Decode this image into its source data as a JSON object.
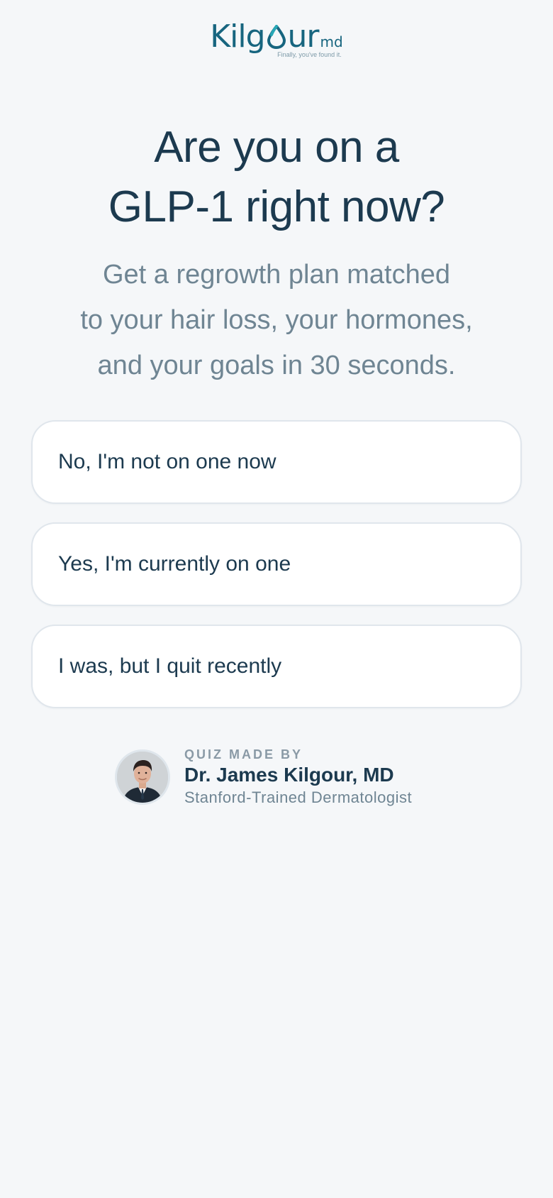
{
  "brand": {
    "logo_word_start": "Kilg",
    "logo_word_end": "ur",
    "logo_suffix": "md",
    "tagline": "Finally, you've found it."
  },
  "question": {
    "headline_line1": "Are you on a",
    "headline_line2": "GLP-1 right now?",
    "subhead_line1": "Get a regrowth plan matched",
    "subhead_line2": "to your hair loss, your hormones,",
    "subhead_line3": "and your goals in 30 seconds."
  },
  "options": [
    {
      "label": "No, I'm not on one now"
    },
    {
      "label": "Yes, I'm currently on one"
    },
    {
      "label": "I was, but I quit recently"
    }
  ],
  "author": {
    "eyebrow": "QUIZ MADE BY",
    "name": "Dr. James Kilgour, MD",
    "title": "Stanford-Trained Dermatologist",
    "avatar_icon": "doctor-portrait"
  },
  "colors": {
    "background": "#f5f7f9",
    "brand": "#17657f",
    "heading": "#1c3a4f",
    "muted": "#6f8593",
    "card": "#ffffff",
    "card_border": "#e0e6ec"
  }
}
